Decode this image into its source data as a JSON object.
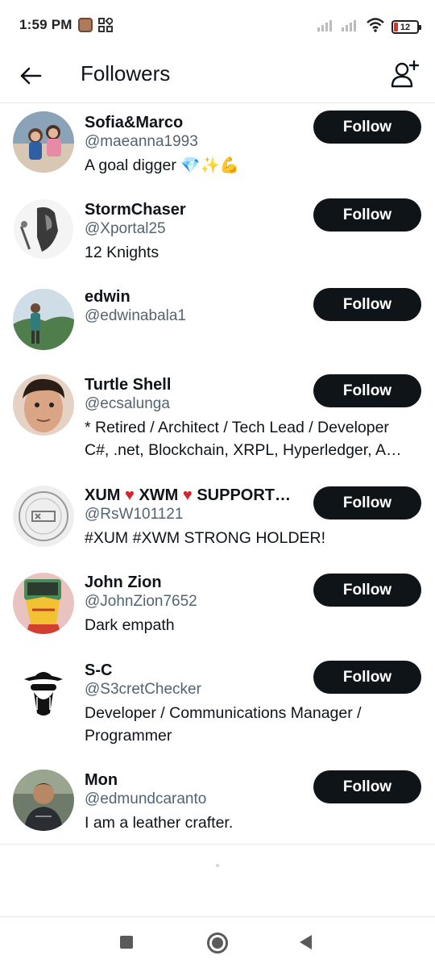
{
  "status_bar": {
    "time": "1:59 PM",
    "battery": "12"
  },
  "header": {
    "title": "Followers",
    "back_icon": "arrow-left-icon",
    "add_icon": "person-add-icon"
  },
  "followers": [
    {
      "name": "Sofia&Marco",
      "handle": "@maeanna1993",
      "bio": "A goal digger 💎✨💪",
      "button": "Follow"
    },
    {
      "name": "StormChaser",
      "handle": "@Xportal25",
      "bio": "12 Knights",
      "button": "Follow"
    },
    {
      "name": "edwin",
      "handle": "@edwinabala1",
      "bio": "",
      "button": "Follow"
    },
    {
      "name": "Turtle Shell",
      "handle": "@ecsalunga",
      "bio_line1": "* Retired / Architect / Tech Lead / Developer",
      "bio_line2": "C#, .net, Blockchain, XRPL, Hyperledger, A…",
      "button": "Follow"
    },
    {
      "name_part1": "XUM",
      "name_part2": "XWM",
      "name_part3": "SUPPORT…",
      "handle": "@RsW101121",
      "bio": "#XUM #XWM STRONG HOLDER!",
      "button": "Follow"
    },
    {
      "name": "John Zion",
      "handle": "@JohnZion7652",
      "bio": "Dark empath",
      "button": "Follow"
    },
    {
      "name": "S-C",
      "handle": "@S3cretChecker",
      "bio_line1": "Developer / Communications Manager /",
      "bio_line2": "Programmer",
      "button": "Follow"
    },
    {
      "name": "Mon",
      "handle": "@edmundcaranto",
      "bio": "I am a leather crafter.",
      "button": "Follow"
    }
  ],
  "colors": {
    "button_bg": "#0f1419",
    "handle": "#536471",
    "heart": "#d8232a"
  }
}
